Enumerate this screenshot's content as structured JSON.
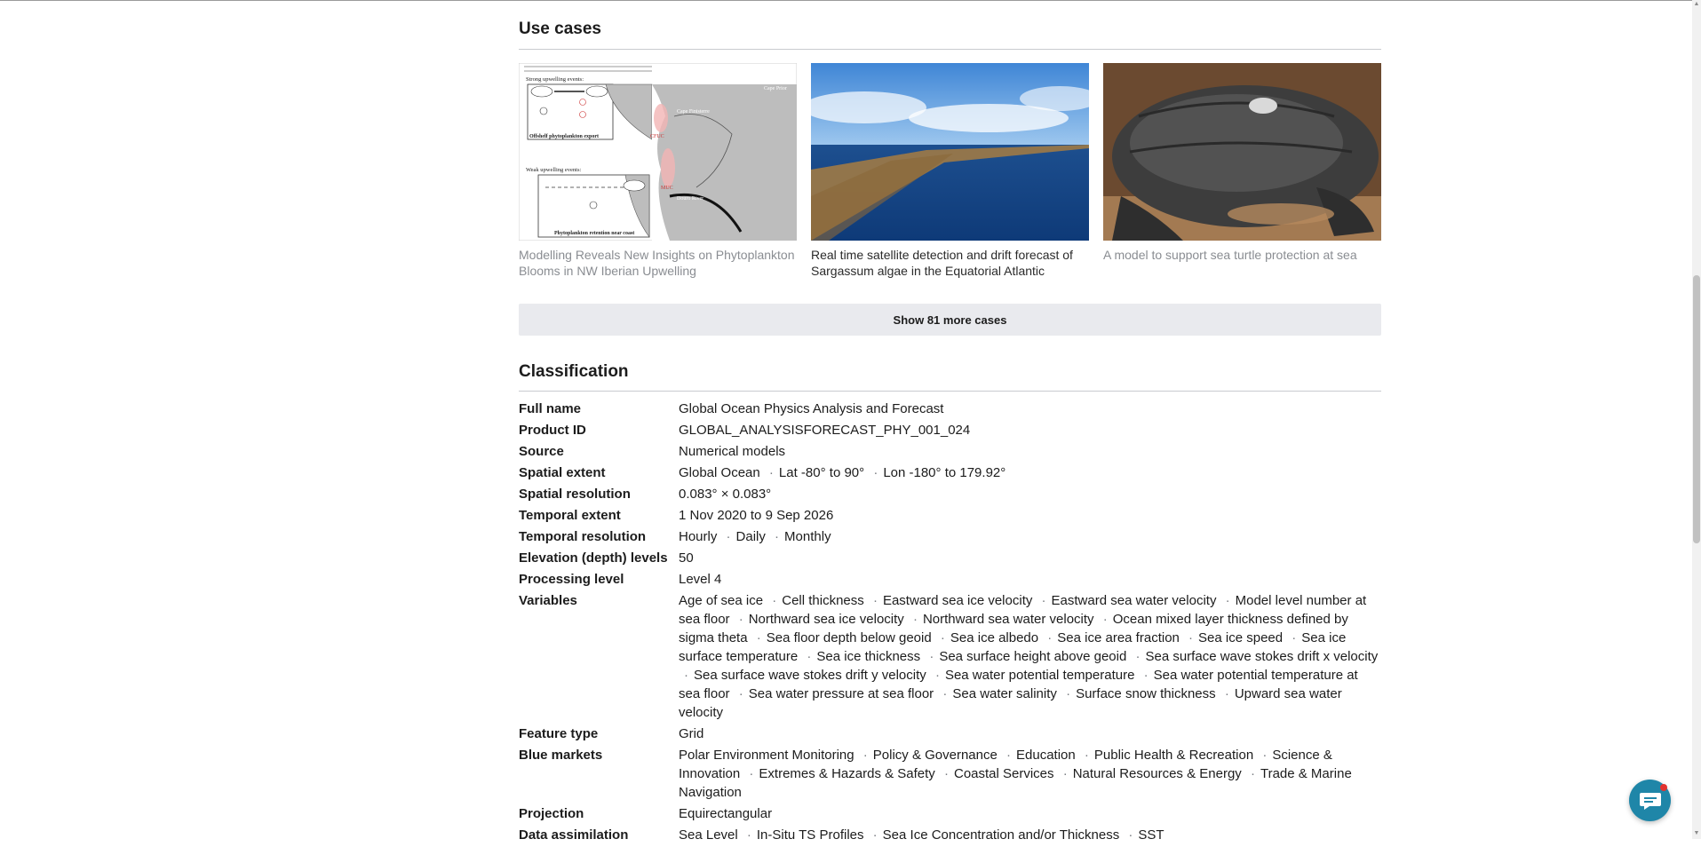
{
  "use_cases": {
    "title": "Use cases",
    "cards": [
      {
        "label": "Modelling Reveals New Insights on Phytoplankton Blooms in NW Iberian Upwelling"
      },
      {
        "label": "Real time satellite detection and drift forecast of Sargassum algae in the Equatorial Atlantic"
      },
      {
        "label": "A model to support sea turtle protection at sea"
      }
    ],
    "show_more_label": "Show 81 more cases"
  },
  "diagram_labels": {
    "strong": "Strong upwelling events:",
    "offshelf": "Offshelf phytoplankton export",
    "weak": "Weak upwelling events:",
    "retention": "Phytoplankton retention near coast",
    "cfuc": "CFUC",
    "muc": "MUC",
    "cape_finisterre": "Cape Finisterre",
    "douro": "Douro River",
    "cape_prior": "Cape Prior"
  },
  "classification": {
    "title": "Classification",
    "rows": [
      {
        "key": "Full name",
        "values": [
          "Global Ocean Physics Analysis and Forecast"
        ]
      },
      {
        "key": "Product ID",
        "values": [
          "GLOBAL_ANALYSISFORECAST_PHY_001_024"
        ]
      },
      {
        "key": "Source",
        "values": [
          "Numerical models"
        ]
      },
      {
        "key": "Spatial extent",
        "values": [
          "Global Ocean",
          "Lat -80° to 90°",
          "Lon -180° to 179.92°"
        ]
      },
      {
        "key": "Spatial resolution",
        "values": [
          "0.083° × 0.083°"
        ]
      },
      {
        "key": "Temporal extent",
        "values": [
          "1 Nov 2020 to 9 Sep 2026"
        ]
      },
      {
        "key": "Temporal resolution",
        "values": [
          "Hourly",
          "Daily",
          "Monthly"
        ]
      },
      {
        "key": "Elevation (depth) levels",
        "values": [
          "50"
        ]
      },
      {
        "key": "Processing level",
        "values": [
          "Level 4"
        ]
      },
      {
        "key": "Variables",
        "values": [
          "Age of sea ice",
          "Cell thickness",
          "Eastward sea ice velocity",
          "Eastward sea water velocity",
          "Model level number at sea floor",
          "Northward sea ice velocity",
          "Northward sea water velocity",
          "Ocean mixed layer thickness defined by sigma theta",
          "Sea floor depth below geoid",
          "Sea ice albedo",
          "Sea ice area fraction",
          "Sea ice speed",
          "Sea ice surface temperature",
          "Sea ice thickness",
          "Sea surface height above geoid",
          "Sea surface wave stokes drift x velocity",
          "Sea surface wave stokes drift y velocity",
          "Sea water potential temperature",
          "Sea water potential temperature at sea floor",
          "Sea water pressure at sea floor",
          "Sea water salinity",
          "Surface snow thickness",
          "Upward sea water velocity"
        ]
      },
      {
        "key": "Feature type",
        "values": [
          "Grid"
        ]
      },
      {
        "key": "Blue markets",
        "values": [
          "Polar Environment Monitoring",
          "Policy & Governance",
          "Education",
          "Public Health & Recreation",
          "Science & Innovation",
          "Extremes & Hazards & Safety",
          "Coastal Services",
          "Natural Resources & Energy",
          "Trade & Marine Navigation"
        ]
      },
      {
        "key": "Projection",
        "values": [
          "Equirectangular"
        ]
      },
      {
        "key": "Data assimilation",
        "values": [
          "Sea Level",
          "In-Situ TS Profiles",
          "Sea Ice Concentration and/or Thickness",
          "SST"
        ]
      }
    ]
  },
  "icons": {
    "chat": "chat-bubble-icon",
    "notification": "notification-dot-icon"
  },
  "colors": {
    "show_more_bg": "#e9eaee",
    "chat_button": "#1f86a8",
    "notification_dot": "#e2322f",
    "muted_text": "#8a8d92"
  }
}
